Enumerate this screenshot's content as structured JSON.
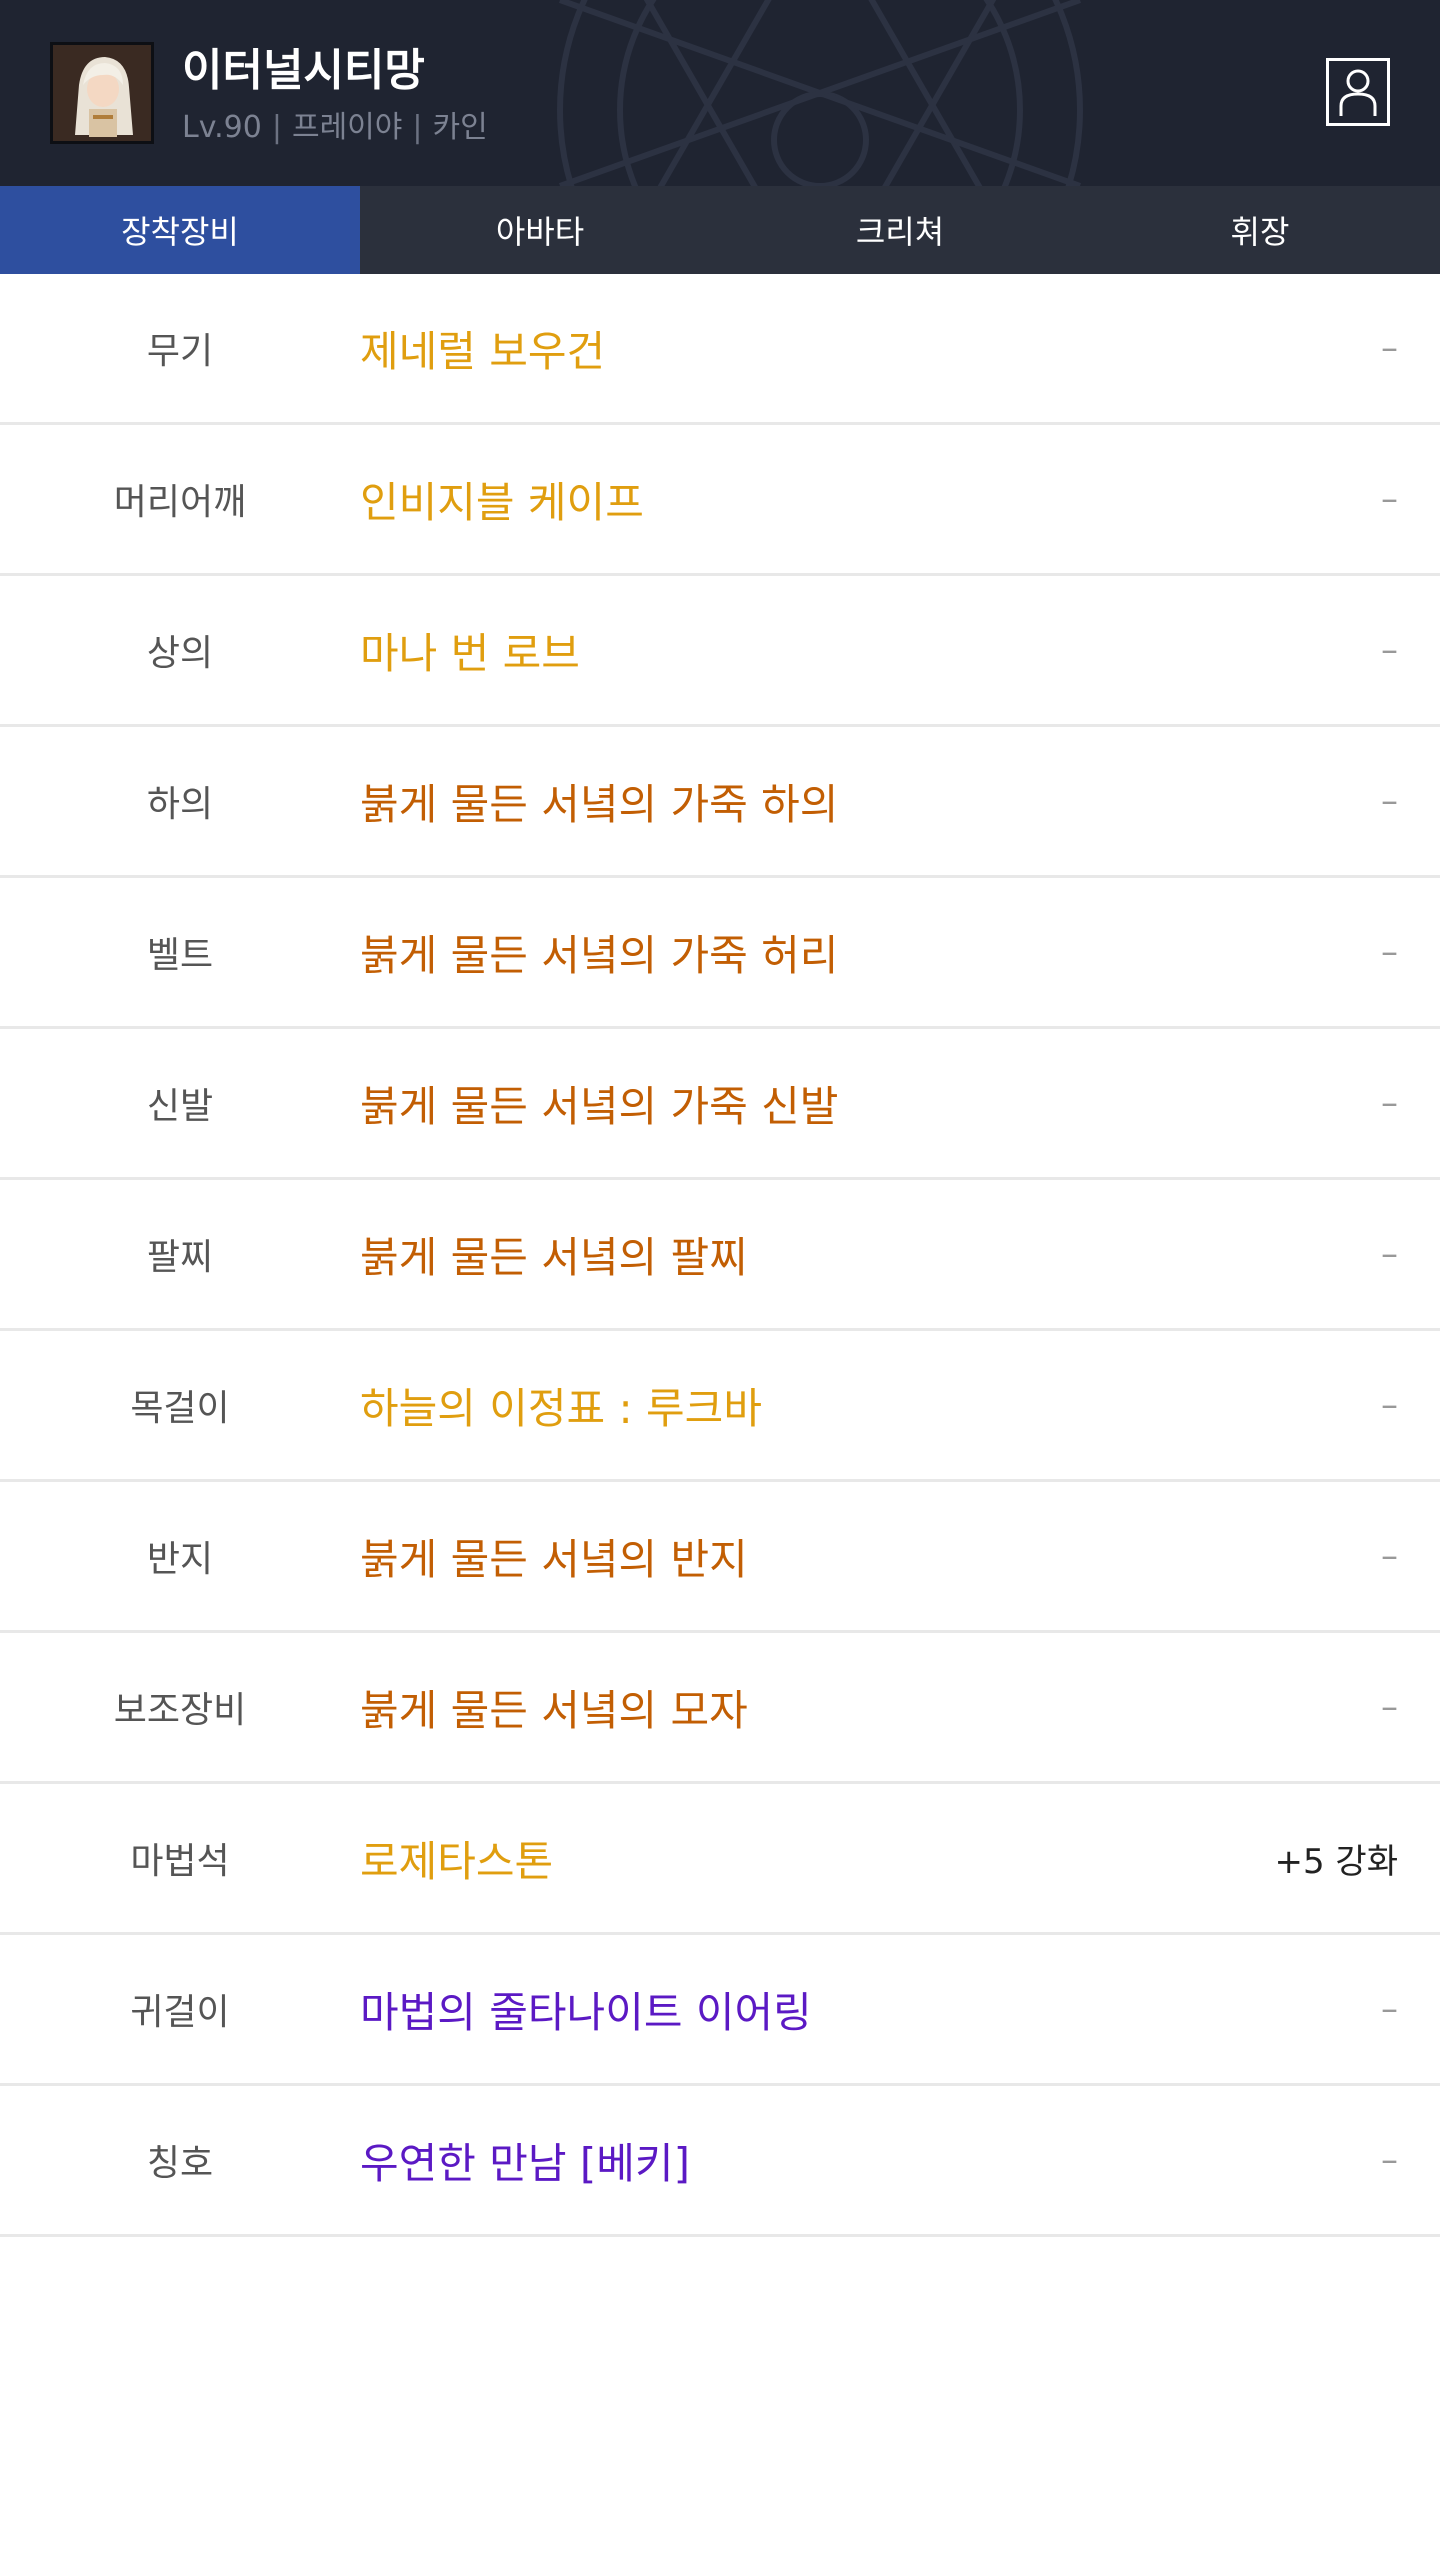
{
  "profile": {
    "name": "이터널시티망",
    "level": "Lv.90",
    "job": "프레이야",
    "server": "카인",
    "separator": "|"
  },
  "tabs": [
    {
      "label": "장착장비",
      "active": true
    },
    {
      "label": "아바타",
      "active": false
    },
    {
      "label": "크리쳐",
      "active": false
    },
    {
      "label": "휘장",
      "active": false
    }
  ],
  "equipment": [
    {
      "slot": "무기",
      "item": "제네럴 보우건",
      "enhance": "–",
      "color": "#e09e0f"
    },
    {
      "slot": "머리어깨",
      "item": "인비지블 케이프",
      "enhance": "–",
      "color": "#e09e0f"
    },
    {
      "slot": "상의",
      "item": "마나 번 로브",
      "enhance": "–",
      "color": "#e09e0f"
    },
    {
      "slot": "하의",
      "item": "붉게 물든 서녘의 가죽 하의",
      "enhance": "–",
      "color": "#c25e03"
    },
    {
      "slot": "벨트",
      "item": "붉게 물든 서녘의 가죽 허리",
      "enhance": "–",
      "color": "#c25e03"
    },
    {
      "slot": "신발",
      "item": "붉게 물든 서녘의 가죽 신발",
      "enhance": "–",
      "color": "#c25e03"
    },
    {
      "slot": "팔찌",
      "item": "붉게 물든 서녘의 팔찌",
      "enhance": "–",
      "color": "#c25e03"
    },
    {
      "slot": "목걸이",
      "item": "하늘의 이정표 : 루크바",
      "enhance": "–",
      "color": "#e09e0f"
    },
    {
      "slot": "반지",
      "item": "붉게 물든 서녘의 반지",
      "enhance": "–",
      "color": "#c25e03"
    },
    {
      "slot": "보조장비",
      "item": "붉게 물든 서녘의 모자",
      "enhance": "–",
      "color": "#c25e03"
    },
    {
      "slot": "마법석",
      "item": "로제타스톤",
      "enhance": "+5 강화",
      "color": "#e09e0f"
    },
    {
      "slot": "귀걸이",
      "item": "마법의 줄타나이트 이어링",
      "enhance": "–",
      "color": "#5b19c4"
    },
    {
      "slot": "칭호",
      "item": "우연한 만남 [베키]",
      "enhance": "–",
      "color": "#5b19c4"
    }
  ],
  "icons": {
    "profile": "person-icon",
    "avatar": "character-portrait"
  },
  "colors": {
    "header_bg": "#1f2431",
    "tab_bar_bg": "#2b303c",
    "tab_active_bg": "#2e4f9f",
    "unique": "#e09e0f",
    "legendary": "#c25e03",
    "rare": "#5b19c4"
  }
}
